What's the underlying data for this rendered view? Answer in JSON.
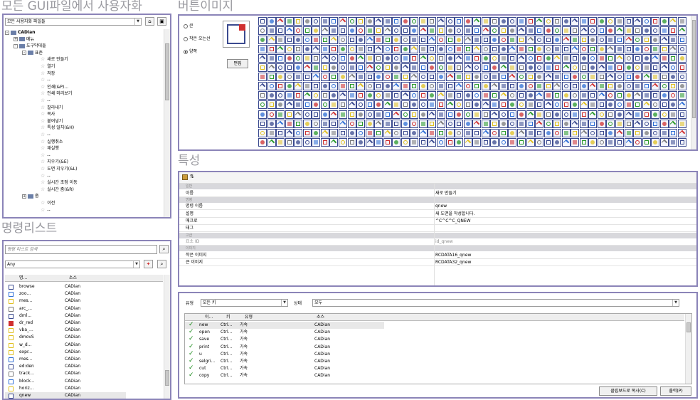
{
  "headings": {
    "all_gui": "모든 GUI파일에서 사용자화",
    "button_image": "버튼이미지",
    "command_list": "명령리스트",
    "properties": "특성"
  },
  "customization": {
    "file_combo": "모든 사용자화 파일들",
    "tree": [
      {
        "label": "CADian",
        "level": 0,
        "expander": "-",
        "icon": "folder-icon"
      },
      {
        "label": "메뉴",
        "level": 1,
        "expander": "+",
        "icon": "folder-icon"
      },
      {
        "label": "도구막대들",
        "level": 1,
        "expander": "-",
        "icon": "folder-icon"
      },
      {
        "label": "표준",
        "level": 2,
        "expander": "-",
        "icon": "folder-icon"
      },
      {
        "label": "새로 만들기",
        "level": 3,
        "icon": "star-icon"
      },
      {
        "label": "열기",
        "level": 3,
        "icon": "star-icon"
      },
      {
        "label": "저장",
        "level": 3,
        "icon": "star-icon"
      },
      {
        "label": "--",
        "level": 3,
        "icon": "star-icon"
      },
      {
        "label": "인쇄(&P)...",
        "level": 3,
        "icon": "star-icon"
      },
      {
        "label": "인쇄 미리보기",
        "level": 3,
        "icon": "star-icon"
      },
      {
        "label": "--",
        "level": 3,
        "icon": "star-icon"
      },
      {
        "label": "잘라내기",
        "level": 3,
        "icon": "star-icon"
      },
      {
        "label": "복사",
        "level": 3,
        "icon": "star-icon"
      },
      {
        "label": "붙여넣기",
        "level": 3,
        "icon": "star-icon"
      },
      {
        "label": "특성 일치(&H)",
        "level": 3,
        "icon": "star-icon"
      },
      {
        "label": "--",
        "level": 3,
        "icon": "star-icon"
      },
      {
        "label": "실행취소",
        "level": 3,
        "icon": "star-icon"
      },
      {
        "label": "재실행",
        "level": 3,
        "icon": "star-icon"
      },
      {
        "label": "--",
        "level": 3,
        "icon": "star-icon"
      },
      {
        "label": "지우기(&E)",
        "level": 3,
        "icon": "star-icon"
      },
      {
        "label": "도면 지우기(&L)",
        "level": 3,
        "icon": "star-icon"
      },
      {
        "label": "--",
        "level": 3,
        "icon": "star-icon"
      },
      {
        "label": "실시간 초점 이동",
        "level": 3,
        "icon": "star-icon"
      },
      {
        "label": "실시간 줌(&R)",
        "level": 3,
        "icon": "star-icon"
      },
      {
        "label": "줌",
        "level": 2,
        "expander": "+",
        "icon": "folder-icon"
      },
      {
        "label": "이전",
        "level": 3,
        "icon": "star-icon"
      },
      {
        "label": "--",
        "level": 3,
        "icon": "star-icon"
      }
    ]
  },
  "button_image": {
    "radios": [
      {
        "label": "큰",
        "checked": false
      },
      {
        "label": "작은 오는선",
        "checked": false
      },
      {
        "label": "양쪽",
        "checked": true
      }
    ],
    "edit_button": "편집",
    "colors": {
      "border": "#3b4a8f",
      "accent_blue": "#2f6fd6",
      "accent_red": "#d03030",
      "accent_green": "#2a9a2a",
      "accent_yellow": "#e0c020"
    }
  },
  "command_list": {
    "search_placeholder": "명령 리스트 검색",
    "filter_combo": "Any",
    "columns": [
      "명...",
      "소스"
    ],
    "rows": [
      {
        "name": "browse",
        "source": "CADian"
      },
      {
        "name": "zoo...",
        "source": "CADian"
      },
      {
        "name": "mes...",
        "source": "CADian"
      },
      {
        "name": "arc_...",
        "source": "CADian"
      },
      {
        "name": "dml...",
        "source": "CADian"
      },
      {
        "name": "dr_red",
        "source": "CADian"
      },
      {
        "name": "vba_...",
        "source": "CADian"
      },
      {
        "name": "dmovS",
        "source": "CADian"
      },
      {
        "name": "w_d...",
        "source": "CADian"
      },
      {
        "name": "expr...",
        "source": "CADian"
      },
      {
        "name": "mes...",
        "source": "CADian"
      },
      {
        "name": "ed:den",
        "source": "CADian"
      },
      {
        "name": "track...",
        "source": "CADian"
      },
      {
        "name": "block...",
        "source": "CADian"
      },
      {
        "name": "horiz...",
        "source": "CADian"
      },
      {
        "name": "qnew",
        "source": "CADian"
      }
    ]
  },
  "properties": {
    "categories": [
      {
        "title": "일반",
        "rows": [
          {
            "key": "이름",
            "value": "새로 만들기"
          }
        ]
      },
      {
        "title": "명령",
        "rows": [
          {
            "key": "명령 이름",
            "value": "qnew"
          },
          {
            "key": "설명",
            "value": "새 도면을 작성합니다."
          },
          {
            "key": "매크로",
            "value": "^C^C^C_QNEW"
          },
          {
            "key": "태그",
            "value": ""
          }
        ]
      },
      {
        "title": "고급",
        "rows": [
          {
            "key": "요소 ID",
            "value": "id_qnew"
          }
        ]
      },
      {
        "title": "이미지",
        "rows": [
          {
            "key": "작은 이미지",
            "value": "RCDATA16_qnew"
          },
          {
            "key": "큰 이미지",
            "value": "RCDATA32_qnew"
          }
        ]
      }
    ]
  },
  "shortcuts": {
    "type_label": "유형",
    "type_combo": "모든 키",
    "status_label": "상태",
    "status_combo": "모두",
    "columns": [
      "이...",
      "키",
      "유형",
      "소스"
    ],
    "rows": [
      {
        "name": "new",
        "key": "Ctrl...",
        "type": "가속",
        "source": "CADian"
      },
      {
        "name": "open",
        "key": "Ctrl...",
        "type": "가속",
        "source": "CADian"
      },
      {
        "name": "save",
        "key": "Ctrl...",
        "type": "가속",
        "source": "CADian"
      },
      {
        "name": "print",
        "key": "Ctrl...",
        "type": "가속",
        "source": "CADian"
      },
      {
        "name": "u",
        "key": "Ctrl...",
        "type": "가속",
        "source": "CADian"
      },
      {
        "name": "selgri...",
        "key": "Ctrl...",
        "type": "가속",
        "source": "CADian"
      },
      {
        "name": "cut",
        "key": "Ctrl...",
        "type": "가속",
        "source": "CADian"
      },
      {
        "name": "copy",
        "key": "Ctrl...",
        "type": "가속",
        "source": "CADian"
      }
    ],
    "copy_button": "클립보드로 복사(C)",
    "print_button": "출력(P)"
  }
}
